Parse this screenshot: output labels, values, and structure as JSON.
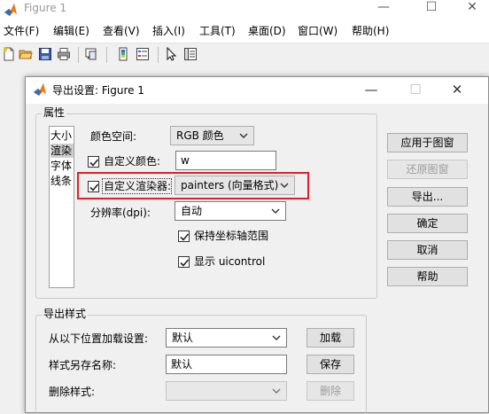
{
  "figure_window": {
    "title": "Figure 1",
    "controls": {
      "minimize": "—",
      "maximize": "☐",
      "close": "✕"
    },
    "menu": [
      "文件(F)",
      "编辑(E)",
      "查看(V)",
      "插入(I)",
      "工具(T)",
      "桌面(D)",
      "窗口(W)",
      "帮助(H)"
    ],
    "toolbar_icons": [
      "new-file-icon",
      "open-folder-icon",
      "save-icon",
      "print-icon",
      "link-plot-icon",
      "insert-colorbar-icon",
      "insert-legend-icon",
      "edit-plot-cursor-icon",
      "property-inspector-icon"
    ]
  },
  "dialog": {
    "title": "导出设置: Figure 1",
    "controls": {
      "minimize": "—",
      "maximize": "☐",
      "close": "✕"
    },
    "properties": {
      "label": "属性",
      "list": [
        "大小",
        "渲染",
        "字体",
        "线条"
      ],
      "selected_index": 1,
      "color_space_label": "颜色空间:",
      "color_space_value": "RGB 颜色",
      "custom_color_label": "自定义颜色:",
      "custom_color_checked": true,
      "custom_color_value": "w",
      "custom_renderer_label": "自定义渲染器:",
      "custom_renderer_checked": true,
      "custom_renderer_value": "painters (向量格式)",
      "resolution_label": "分辨率(dpi):",
      "resolution_value": "自动",
      "keep_axes_label": "保持坐标轴范围",
      "keep_axes_checked": true,
      "show_uicontrol_label": "显示 uicontrol",
      "show_uicontrol_checked": true
    },
    "side_buttons": {
      "apply": "应用于图窗",
      "restore": "还原图窗",
      "export": "导出...",
      "ok": "确定",
      "cancel": "取消",
      "help": "帮助"
    },
    "export_styles": {
      "label": "导出样式",
      "load_label": "从以下位置加载设置:",
      "load_value": "默认",
      "load_button": "加载",
      "save_label": "样式另存名称:",
      "save_value": "默认",
      "save_button": "保存",
      "delete_label": "删除样式:",
      "delete_value": "",
      "delete_button": "删除"
    },
    "colors": {
      "highlight": "#e51c23"
    }
  }
}
